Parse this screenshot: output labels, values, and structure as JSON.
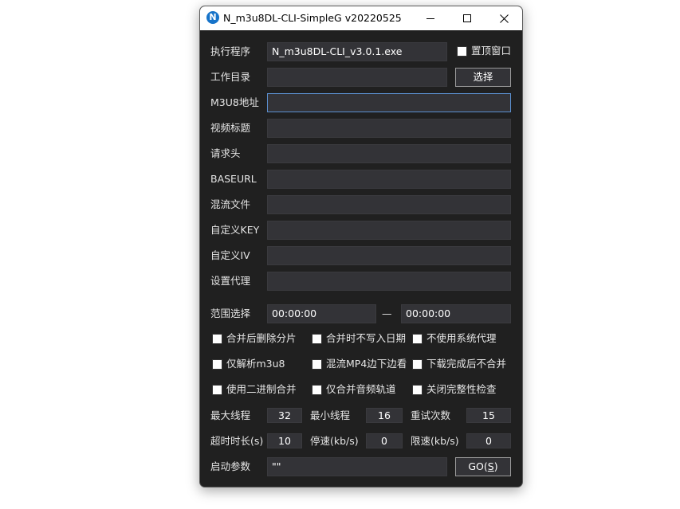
{
  "window": {
    "title": "N_m3u8DL-CLI-SimpleG v20220525",
    "icon_letter": "N",
    "controls": [
      "minimize-icon",
      "maximize-icon",
      "close-icon"
    ]
  },
  "colors": {
    "background": "#202020",
    "field": "#333337",
    "focus": "#5b8fcf",
    "icon": "#1673c9"
  },
  "form": {
    "exe": {
      "label": "执行程序",
      "value": "N_m3u8DL-CLI_v3.0.1.exe"
    },
    "topmost": {
      "label": "置顶窗口",
      "checked": false
    },
    "workdir": {
      "label": "工作目录",
      "value": "",
      "button": "选择"
    },
    "m3u8": {
      "label": "M3U8地址",
      "value": ""
    },
    "title": {
      "label": "视频标题",
      "value": ""
    },
    "headers": {
      "label": "请求头",
      "value": ""
    },
    "baseurl": {
      "label": "BASEURL",
      "value": ""
    },
    "mux": {
      "label": "混流文件",
      "value": ""
    },
    "key": {
      "label": "自定义KEY",
      "value": ""
    },
    "iv": {
      "label": "自定义IV",
      "value": ""
    },
    "proxy": {
      "label": "设置代理",
      "value": ""
    },
    "range": {
      "label": "范围选择",
      "start": "00:00:00",
      "separator": "—",
      "end": "00:00:00"
    }
  },
  "options": [
    {
      "label": "合并后删除分片",
      "checked": false
    },
    {
      "label": "合并时不写入日期",
      "checked": false
    },
    {
      "label": "不使用系统代理",
      "checked": false
    },
    {
      "label": "仅解析m3u8",
      "checked": false
    },
    {
      "label": "混流MP4边下边看",
      "checked": false
    },
    {
      "label": "下载完成后不合并",
      "checked": false
    },
    {
      "label": "使用二进制合并",
      "checked": false
    },
    {
      "label": "仅合并音频轨道",
      "checked": false
    },
    {
      "label": "关闭完整性检查",
      "checked": false
    }
  ],
  "numbers": {
    "max_threads": {
      "label": "最大线程",
      "value": "32"
    },
    "min_threads": {
      "label": "最小线程",
      "value": "16"
    },
    "retry": {
      "label": "重试次数",
      "value": "15"
    },
    "timeout": {
      "label": "超时时长(s)",
      "value": "10"
    },
    "stop_speed": {
      "label": "停速(kb/s)",
      "value": "0"
    },
    "limit_speed": {
      "label": "限速(kb/s)",
      "value": "0"
    }
  },
  "launch": {
    "label": "启动参数",
    "value": "\"\"",
    "go_label": "GO(",
    "go_key": "S",
    "go_suffix": ")"
  }
}
